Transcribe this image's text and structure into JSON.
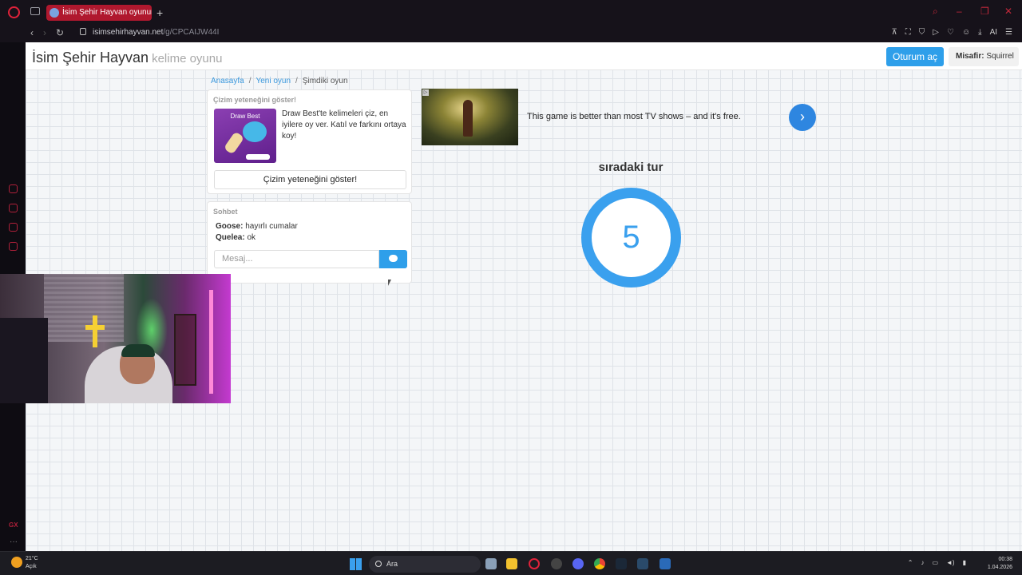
{
  "browser": {
    "tab_title": "İsim Şehir Hayvan oyununa",
    "new_tab": "+",
    "url_domain": "isimsehirhayvan.net",
    "url_path": "/g/CPCAIJW44I",
    "ai_label": "AI"
  },
  "header": {
    "title": "İsim Şehir Hayvan",
    "subtitle": "kelime oyunu",
    "login_label": "Oturum aç",
    "guest_prefix": "Misafir:",
    "guest_name": "Squirrel"
  },
  "breadcrumb": {
    "home": "Anasayfa",
    "new_game": "Yeni oyun",
    "current": "Şimdiki oyun",
    "separator": "/"
  },
  "promo": {
    "heading": "Çizim yeteneğini göster!",
    "image_title": "Draw Best",
    "description": "Draw Best'te kelimeleri çiz, en iyilere oy ver. Katıl ve farkını ortaya koy!",
    "button_label": "Çizim yeteneğini göster!"
  },
  "chat": {
    "heading": "Sohbet",
    "messages": [
      {
        "user": "Goose:",
        "text": "hayırlı cumalar"
      },
      {
        "user": "Quelea:",
        "text": "ok"
      }
    ],
    "input_placeholder": "Mesaj..."
  },
  "ad": {
    "text": "This game is better than most TV shows – and it's free."
  },
  "round": {
    "label": "sıradaki tur",
    "countdown": "5"
  },
  "taskbar": {
    "temperature": "21°C",
    "weather": "Açık",
    "search_label": "Ara",
    "time": "00:38",
    "date": "1.04.2026"
  },
  "colors": {
    "accent": "#2e9fea",
    "tab_active": "#b0182e",
    "ring": "#3aa0ee"
  }
}
